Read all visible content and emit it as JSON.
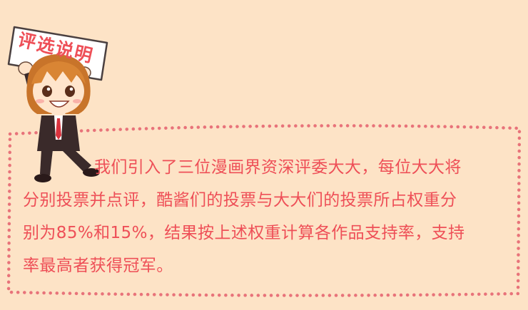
{
  "sign": {
    "text": "评选说明"
  },
  "body": {
    "line1": "我们引入了三位漫画界资深评委大大，每位大大将",
    "line2": "分别投票并点评，酷酱们的投票与大大们的投票所占权重分",
    "line3": "别为85%和15%，结果按上述权重计算各作品支持率，支持",
    "line4": "率最高者获得冠军。"
  },
  "colors": {
    "background": "#fde3c6",
    "accent": "#ee4f57",
    "dots": "#e8737a"
  },
  "icons": [
    "mascot-illustration",
    "sign-board"
  ]
}
